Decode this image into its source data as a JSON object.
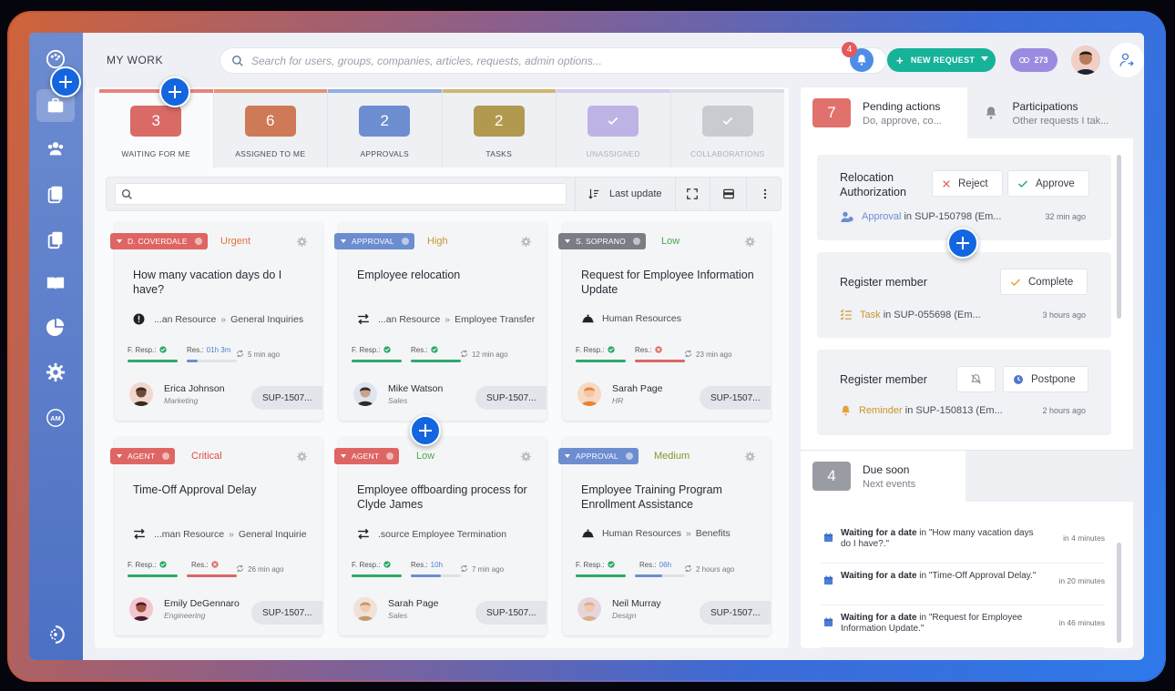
{
  "topbar": {
    "section_label": "MY WORK",
    "search_placeholder": "Search for users, groups, companies, articles, requests, admin options...",
    "notification_count": "4",
    "new_request_label": "NEW REQUEST",
    "credits": "273"
  },
  "tabs": [
    {
      "count": "3",
      "label": "WAITING FOR ME",
      "color": "#d96a66",
      "bar": "#e9827e"
    },
    {
      "count": "6",
      "label": "ASSIGNED TO ME",
      "color": "#cf7a56",
      "bar": "#e39474"
    },
    {
      "count": "2",
      "label": "APPROVALS",
      "color": "#6c8dd0",
      "bar": "#93aee2"
    },
    {
      "count": "2",
      "label": "TASKS",
      "color": "#b19a4f",
      "bar": "#cdb872"
    },
    {
      "count": "",
      "label": "UNASSIGNED",
      "color": "#bfb3e6",
      "bar": "#d6cdef"
    },
    {
      "count": "",
      "label": "COLLABORATIONS",
      "color": "#c9cbd0",
      "bar": "#dcdde1"
    }
  ],
  "toolbar": {
    "sort_label": "Last update"
  },
  "cards": [
    {
      "tag": "D. COVERDALE",
      "tag_color": "#de6563",
      "priority": "Urgent",
      "priority_color": "#e0733f",
      "title": "How many vacation days do I have?",
      "path_a": "...an Resource",
      "path_b": "General Inquiries",
      "first_resp": "F. Resp.:",
      "res": "Res.:",
      "res_extra": "01h 3m",
      "ago": "5 min ago",
      "person": "Erica Johnson",
      "dept": "Marketing",
      "ticket": "SUP-1507..."
    },
    {
      "tag": "APPROVAL",
      "tag_color": "#6c8dd0",
      "priority": "High",
      "priority_color": "#c9972c",
      "title": "Employee relocation",
      "path_a": "...an Resource",
      "path_b": "Employee Transfer",
      "first_resp": "F. Resp.:",
      "res": "Res.:",
      "res_extra": "",
      "ago": "12 min ago",
      "person": "Mike Watson",
      "dept": "Sales",
      "ticket": "SUP-1507..."
    },
    {
      "tag": "S. SOPRANO",
      "tag_color": "#7b7d84",
      "priority": "Low",
      "priority_color": "#4aa752",
      "title": "Request for Employee Information Update",
      "path_a": "Human Resources",
      "path_b": "",
      "first_resp": "F. Resp.:",
      "res": "Res.:",
      "res_extra": "",
      "ago": "23 min ago",
      "person": "Sarah Page",
      "dept": "HR",
      "ticket": "SUP-1507..."
    },
    {
      "tag": "AGENT",
      "tag_color": "#de6563",
      "priority": "Critical",
      "priority_color": "#e04a4a",
      "title": "Time-Off Approval Delay",
      "path_a": "...man Resource",
      "path_b": "General Inquirie",
      "first_resp": "F. Resp.:",
      "res": "Res.:",
      "res_extra": "",
      "ago": "26 min ago",
      "person": "Emily DeGennaro",
      "dept": "Engineering",
      "ticket": "SUP-1507..."
    },
    {
      "tag": "AGENT",
      "tag_color": "#de6563",
      "priority": "Low",
      "priority_color": "#4aa752",
      "title": "Employee offboarding process for Clyde James",
      "path_a": ".source Employee Termination",
      "path_b": "",
      "first_resp": "F. Resp.:",
      "res": "Res.:",
      "res_extra": "10h",
      "ago": "7 min ago",
      "person": "Sarah Page",
      "dept": "Sales",
      "ticket": "SUP-1507..."
    },
    {
      "tag": "APPROVAL",
      "tag_color": "#6c8dd0",
      "priority": "Medium",
      "priority_color": "#7a9a2a",
      "title": "Employee Training Program Enrollment Assistance",
      "path_a": "Human Resources",
      "path_b": "Benefits",
      "first_resp": "F. Resp.:",
      "res": "Res.:",
      "res_extra": "06h",
      "ago": "2 hours ago",
      "person": "Neil Murray",
      "dept": "Design",
      "ticket": "SUP-1507..."
    }
  ],
  "pending": {
    "count": "7",
    "title": "Pending actions",
    "subtitle": "Do, approve, co...",
    "other_title": "Participations",
    "other_subtitle": "Other requests I tak...",
    "items": [
      {
        "title": "Relocation Authorization",
        "btn1": "Reject",
        "btn2": "Approve",
        "kind": "Approval",
        "ref": "in SUP-150798 (Em...",
        "time": "32 min ago"
      },
      {
        "title": "Register member",
        "btn1": "",
        "btn2": "Complete",
        "kind": "Task",
        "ref": "in SUP-055698 (Em...",
        "time": "3 hours ago"
      },
      {
        "title": "Register member",
        "btn1": "",
        "btn2": "Postpone",
        "kind": "Reminder",
        "ref": "in SUP-150813 (Em...",
        "time": "2 hours ago"
      }
    ]
  },
  "due": {
    "count": "4",
    "title": "Due soon",
    "subtitle": "Next events",
    "items": [
      {
        "bold": "Waiting for a date",
        "rest": " in \"How many vacation days do I have?.\"",
        "time": "in 4 minutes"
      },
      {
        "bold": "Waiting for a date",
        "rest": " in \"Time-Off Approval Delay.\"",
        "time": "in 20 minutes"
      },
      {
        "bold": "Waiting for a date",
        "rest": " in \"Request for Employee Information Update.\"",
        "time": "in 46 minutes"
      }
    ]
  }
}
